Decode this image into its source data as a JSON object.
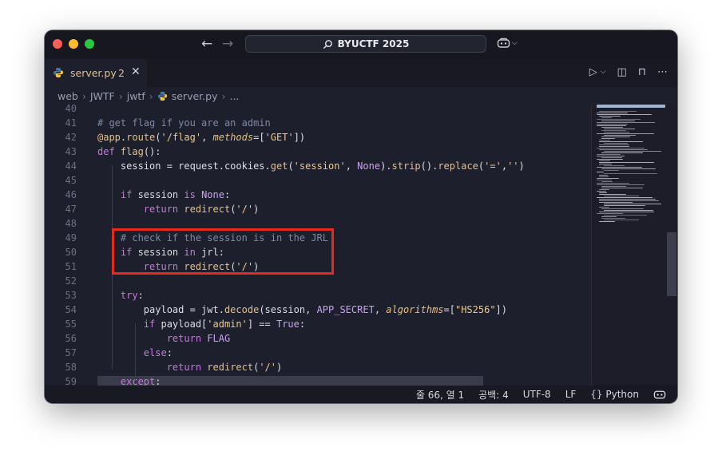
{
  "titlebar": {
    "search_label": "BYUCTF 2025"
  },
  "tab": {
    "filename": "server.py",
    "badge": "2"
  },
  "breadcrumb": [
    "web",
    "JWTF",
    "jwtf",
    "server.py",
    "..."
  ],
  "editor": {
    "line_numbers": [
      "40",
      "41",
      "42",
      "43",
      "44",
      "45",
      "46",
      "47",
      "48",
      "49",
      "50",
      "51",
      "52",
      "53",
      "54",
      "55",
      "56",
      "57",
      "58",
      "59"
    ],
    "lines": [
      {
        "text": ""
      },
      {
        "text": "# get flag if you are an admin"
      },
      {
        "text": "@app.route('/flag', methods=['GET'])"
      },
      {
        "text": "def flag():"
      },
      {
        "text": "    session = request.cookies.get('session', None).strip().replace('=','')"
      },
      {
        "text": ""
      },
      {
        "text": "    if session is None:"
      },
      {
        "text": "        return redirect('/')"
      },
      {
        "text": ""
      },
      {
        "text": "    # check if the session is in the JRL"
      },
      {
        "text": "    if session in jrl:"
      },
      {
        "text": "        return redirect('/')"
      },
      {
        "text": ""
      },
      {
        "text": "    try:"
      },
      {
        "text": "        payload = jwt.decode(session, APP_SECRET, algorithms=[\"HS256\"])"
      },
      {
        "text": "        if payload['admin'] == True:"
      },
      {
        "text": "            return FLAG"
      },
      {
        "text": "        else:"
      },
      {
        "text": "            return redirect('/')"
      },
      {
        "text": "    except:"
      }
    ]
  },
  "statusbar": {
    "position": "줄 66, 열 1",
    "spaces": "공백: 4",
    "encoding": "UTF-8",
    "eol": "LF",
    "language": "Python"
  },
  "colors": {
    "highlight_border": "#e62b1e",
    "editor_bg": "#1e1f2c"
  }
}
